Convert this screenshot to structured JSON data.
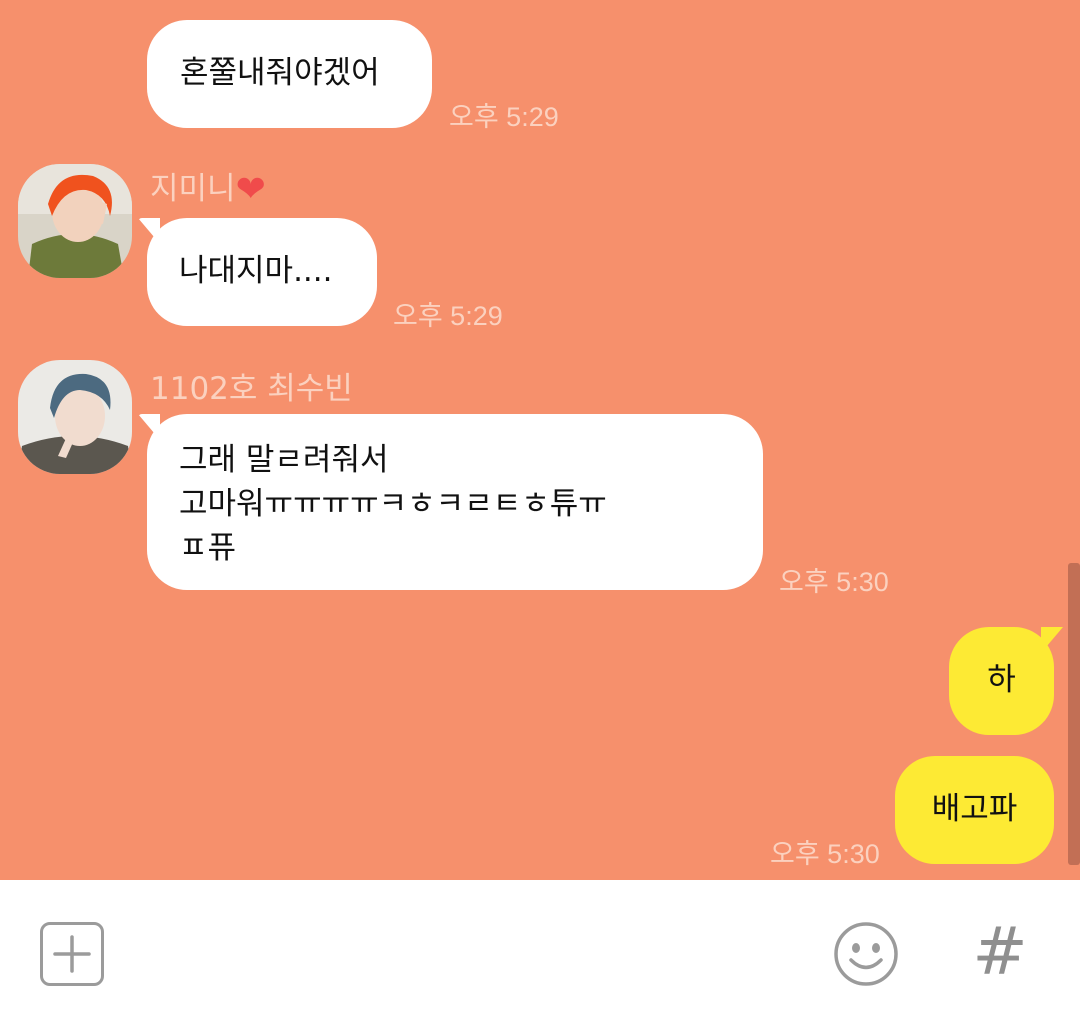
{
  "messages": [
    {
      "text": "혼쭐내줘야겠어",
      "time": "오후 5:29"
    },
    {
      "sender": "지미니",
      "text": "나대지마....",
      "time": "오후 5:29"
    },
    {
      "sender": "1102호 최수빈",
      "lines": [
        "그래 말ㄹ려줘서",
        "고마워ㅠㅠㅠㅠㅋㅎㅋㄹㅌㅎ튜ㅠ",
        "ㅍ퓨"
      ],
      "time": "오후 5:30"
    },
    {
      "text": "하"
    },
    {
      "text": "배고파",
      "time": "오후 5:30"
    }
  ],
  "input_bar": {
    "attach_icon": "plus-square-icon",
    "emoji_icon": "smiley-icon",
    "hash_icon": "hash-icon",
    "hash_label": "#"
  },
  "colors": {
    "background": "#f6906c",
    "my_bubble": "#fdea34",
    "other_bubble": "#ffffff",
    "timestamp": "#fbd1bf"
  }
}
